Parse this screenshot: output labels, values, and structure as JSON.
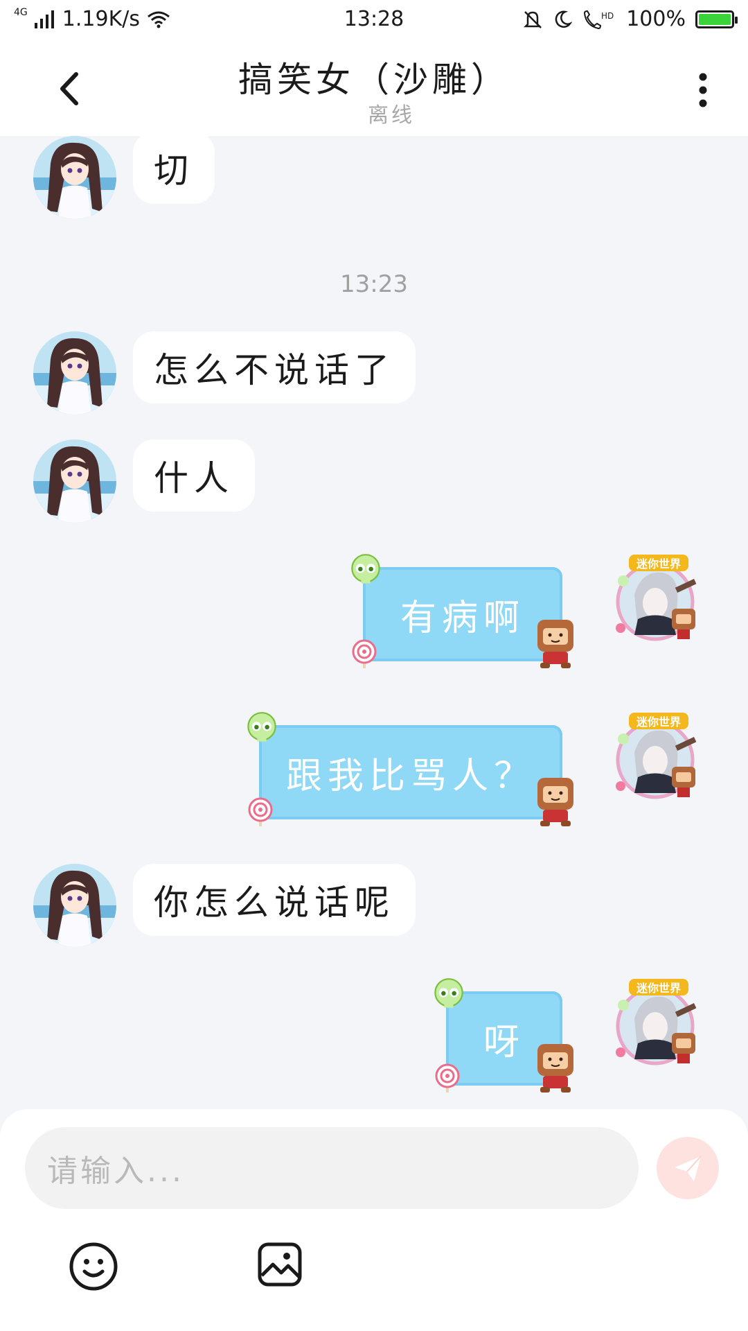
{
  "status_bar": {
    "network_type": "4G",
    "speed": "1.19K/s",
    "time": "13:28",
    "hd_label": "HD",
    "battery": "100%",
    "icons": [
      "signal-icon",
      "wifi-icon",
      "mute-icon",
      "moon-icon",
      "hd-call-icon",
      "battery-icon"
    ]
  },
  "header": {
    "title": "搞笑女（沙雕）",
    "subtitle": "离线",
    "back_icon": "chevron-left-icon",
    "more_icon": "more-vertical-icon"
  },
  "chat": {
    "timestamp": "13:23",
    "messages": [
      {
        "side": "left",
        "text": "切"
      },
      {
        "side": "left",
        "text": "怎么不说话了"
      },
      {
        "side": "left",
        "text": "什人"
      },
      {
        "side": "right",
        "text": "有病啊"
      },
      {
        "side": "right",
        "text": "跟我比骂人？"
      },
      {
        "side": "left",
        "text": "你怎么说话呢"
      },
      {
        "side": "right",
        "text": "呀"
      }
    ],
    "avatar_badge": "迷你世界"
  },
  "composer": {
    "placeholder": "请输入...",
    "send_icon": "send-icon",
    "emoji_icon": "emoji-icon",
    "image_icon": "image-icon"
  },
  "colors": {
    "accent_bubble": "#8fd8f6",
    "send_button": "#fde2df",
    "background": "#f3f5f8"
  }
}
